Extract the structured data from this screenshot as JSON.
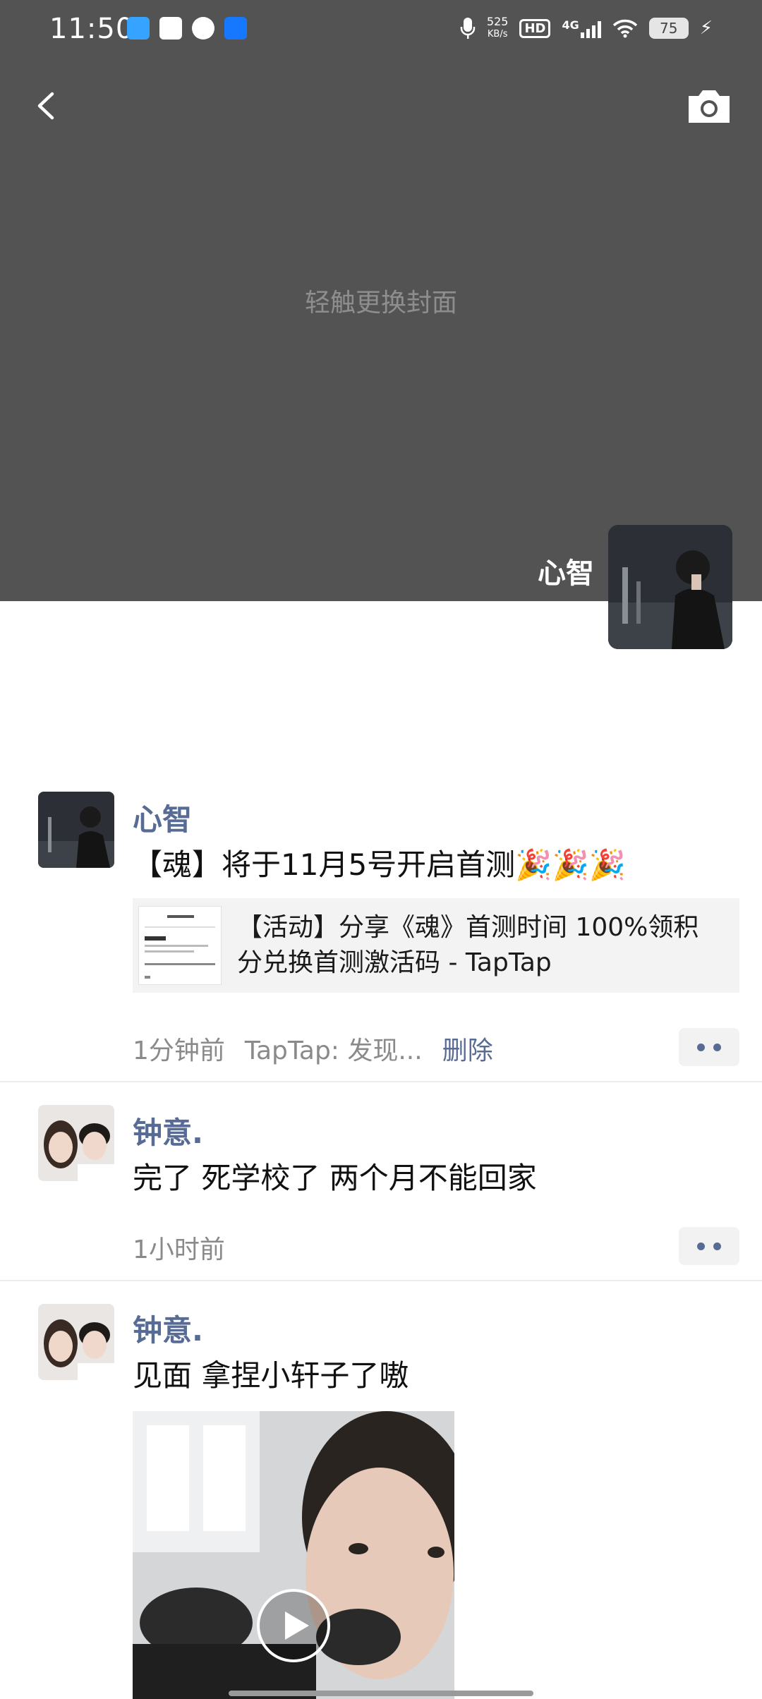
{
  "status_bar": {
    "time": "11:50",
    "net_speed_value": "525",
    "net_speed_unit": "KB/s",
    "hd": "HD",
    "network": "4G",
    "battery": "75"
  },
  "cover": {
    "hint": "轻触更换封面",
    "profile_name": "心智"
  },
  "posts": [
    {
      "author": "心智",
      "text": "【魂】将于11月5号开启首测🎉🎉🎉",
      "link": {
        "title": "【活动】分享《魂》首测时间 100%领积分兑换首测激活码 - TapTap"
      },
      "time": "1分钟前",
      "source": "TapTap: 发现...",
      "delete_label": "删除"
    },
    {
      "author": "钟意.",
      "text": "完了 死学校了 两个月不能回家",
      "time": "1小时前"
    },
    {
      "author": "钟意.",
      "text": "见面 拿捏小轩子了嗷"
    }
  ],
  "icons": {
    "back": "back-arrow-icon",
    "camera": "camera-icon",
    "more": "more-dots-icon",
    "play": "play-icon"
  },
  "colors": {
    "link_blue": "#576b95",
    "cover_gray": "#535353"
  }
}
